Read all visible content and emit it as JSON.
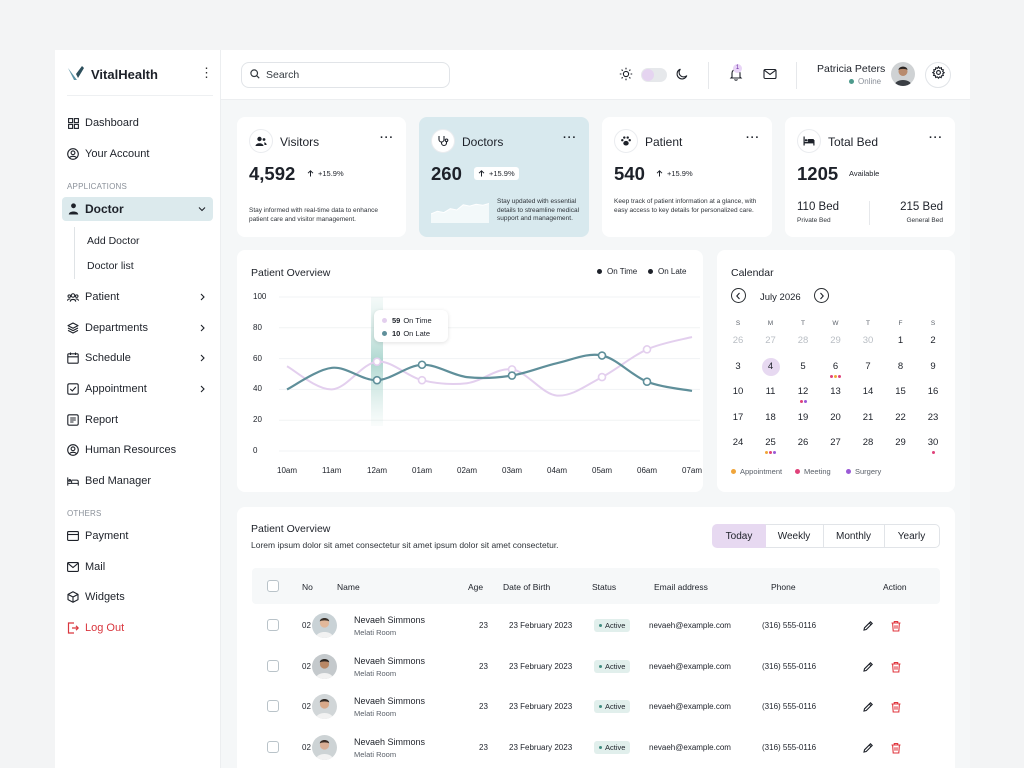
{
  "brand": {
    "name": "VitalHealth",
    "accent": "#5a93a6"
  },
  "sidebar": {
    "main": [
      {
        "label": "Dashboard",
        "icon": "grid-icon"
      },
      {
        "label": "Your Account",
        "icon": "user-circle-icon"
      }
    ],
    "applications_label": "APPLICATIONS",
    "doctor": {
      "label": "Doctor",
      "icon": "doctor-icon",
      "expanded": true
    },
    "doctor_sub": [
      "Add Doctor",
      "Doctor list"
    ],
    "apps": [
      {
        "label": "Patient",
        "icon": "users-icon",
        "has_children": true
      },
      {
        "label": "Departments",
        "icon": "layers-icon",
        "has_children": true
      },
      {
        "label": "Schedule",
        "icon": "calendar-icon",
        "has_children": true
      },
      {
        "label": "Appointment",
        "icon": "check-square-icon",
        "has_children": true
      },
      {
        "label": "Report",
        "icon": "report-icon",
        "has_children": false
      },
      {
        "label": "Human Resources",
        "icon": "person-circle-icon",
        "has_children": false
      },
      {
        "label": "Bed Manager",
        "icon": "bed-icon",
        "has_children": false
      }
    ],
    "others_label": "OTHERS",
    "others": [
      {
        "label": "Payment",
        "icon": "card-icon"
      },
      {
        "label": "Mail",
        "icon": "mail-icon"
      },
      {
        "label": "Widgets",
        "icon": "cube-icon"
      }
    ],
    "logout": {
      "label": "Log Out",
      "icon": "logout-icon",
      "color": "#d9363e"
    }
  },
  "header": {
    "search_label": "Search",
    "notifications_count": "1",
    "user_name": "Patricia Peters",
    "user_status": "Online"
  },
  "stats": [
    {
      "title": "Visitors",
      "icon": "user-group-icon",
      "value": "4,592",
      "change": "+15.9%",
      "description": "Stay informed with real-time data to enhance patient care and visitor management."
    },
    {
      "title": "Doctors",
      "icon": "stethoscope-icon",
      "value": "260",
      "change": "+15.9%",
      "description": "Stay updated with essential details to streamline medical support and management.",
      "sparkline": [
        0.35,
        0.45,
        0.4,
        0.55,
        0.5,
        0.7,
        0.65,
        0.72,
        0.68,
        0.75
      ]
    },
    {
      "title": "Patient",
      "icon": "paw-icon",
      "value": "540",
      "change": "+15.9%",
      "description": "Keep track of patient information at a glance, with easy access to key details for personalized care."
    },
    {
      "title": "Total Bed",
      "icon": "bed-icon",
      "value": "1205",
      "status": "Available",
      "private_value": "110 Bed",
      "private_label": "Private Bed",
      "general_value": "215 Bed",
      "general_label": "General Bed"
    }
  ],
  "overview": {
    "title": "Patient Overview",
    "legend": [
      "On Time",
      "On Late"
    ],
    "tooltip": {
      "on_time_value": "59",
      "on_time_label": "On Time",
      "on_late_value": "10",
      "on_late_label": "On Late"
    }
  },
  "chart_data": {
    "type": "line",
    "x": [
      "10am",
      "11am",
      "12am",
      "01am",
      "02am",
      "03am",
      "04am",
      "05am",
      "06am",
      "07am"
    ],
    "ylim": [
      0,
      100
    ],
    "yticks": [
      100,
      80,
      60,
      40,
      20,
      0
    ],
    "series": [
      {
        "name": "On Time",
        "color": "#e3cfee",
        "values": [
          55,
          40,
          58,
          46,
          44,
          53,
          36,
          48,
          66,
          74
        ],
        "markers": [
          2,
          3,
          5,
          7,
          8
        ]
      },
      {
        "name": "On Late",
        "color": "#5f8f9a",
        "values": [
          40,
          54,
          46,
          56,
          48,
          49,
          57,
          62,
          45,
          39
        ],
        "markers": [
          2,
          3,
          5,
          7,
          8
        ]
      }
    ],
    "highlight_index": 2
  },
  "calendar": {
    "title": "Calendar",
    "month": "July 2026",
    "weekdays": [
      "S",
      "M",
      "T",
      "W",
      "T",
      "F",
      "S"
    ],
    "weeks": [
      [
        {
          "d": "26",
          "m": true
        },
        {
          "d": "27",
          "m": true
        },
        {
          "d": "28",
          "m": true
        },
        {
          "d": "29",
          "m": true
        },
        {
          "d": "30",
          "m": true
        },
        {
          "d": "1"
        },
        {
          "d": "2"
        }
      ],
      [
        {
          "d": "3"
        },
        {
          "d": "4",
          "sel": true
        },
        {
          "d": "5"
        },
        {
          "d": "6",
          "dots": [
            "#e0427a",
            "#f0a53a",
            "#e0427a"
          ]
        },
        {
          "d": "7"
        },
        {
          "d": "8"
        },
        {
          "d": "9"
        }
      ],
      [
        {
          "d": "10"
        },
        {
          "d": "11"
        },
        {
          "d": "12",
          "dots": [
            "#e0427a",
            "#9a5ad6"
          ]
        },
        {
          "d": "13"
        },
        {
          "d": "14"
        },
        {
          "d": "15"
        },
        {
          "d": "16"
        }
      ],
      [
        {
          "d": "17"
        },
        {
          "d": "18"
        },
        {
          "d": "19"
        },
        {
          "d": "20"
        },
        {
          "d": "21"
        },
        {
          "d": "22"
        },
        {
          "d": "23"
        }
      ],
      [
        {
          "d": "24"
        },
        {
          "d": "25",
          "dots": [
            "#f0a53a",
            "#e0427a",
            "#9a5ad6"
          ]
        },
        {
          "d": "26"
        },
        {
          "d": "27"
        },
        {
          "d": "28"
        },
        {
          "d": "29"
        },
        {
          "d": "30",
          "dots": [
            "#e0427a"
          ]
        }
      ]
    ],
    "legend": [
      {
        "label": "Appointment",
        "color": "#f0a53a"
      },
      {
        "label": "Meeting",
        "color": "#e0427a"
      },
      {
        "label": "Surgery",
        "color": "#9a5ad6"
      }
    ]
  },
  "table": {
    "title": "Patient Overview",
    "subtitle": "Lorem ipsum dolor sit amet consectetur sit amet ipsum dolor sit amet consectetur.",
    "filters": [
      "Today",
      "Weekly",
      "Monthly",
      "Yearly"
    ],
    "active_filter": "Today",
    "columns": [
      "No",
      "Name",
      "Age",
      "Date of Birth",
      "Status",
      "Email address",
      "Phone",
      "Action"
    ],
    "rows": [
      {
        "no": "02",
        "name": "Nevaeh Simmons",
        "room": "Melati Room",
        "age": "23",
        "dob": "23 February 2023",
        "status": "Active",
        "email": "nevaeh@example.com",
        "phone": "(316) 555-0116"
      },
      {
        "no": "02",
        "name": "Nevaeh Simmons",
        "room": "Melati Room",
        "age": "23",
        "dob": "23 February 2023",
        "status": "Active",
        "email": "nevaeh@example.com",
        "phone": "(316) 555-0116"
      },
      {
        "no": "02",
        "name": "Nevaeh Simmons",
        "room": "Melati Room",
        "age": "23",
        "dob": "23 February 2023",
        "status": "Active",
        "email": "nevaeh@example.com",
        "phone": "(316) 555-0116"
      },
      {
        "no": "02",
        "name": "Nevaeh Simmons",
        "room": "Melati Room",
        "age": "23",
        "dob": "23 February 2023",
        "status": "Active",
        "email": "nevaeh@example.com",
        "phone": "(316) 555-0116"
      }
    ]
  }
}
